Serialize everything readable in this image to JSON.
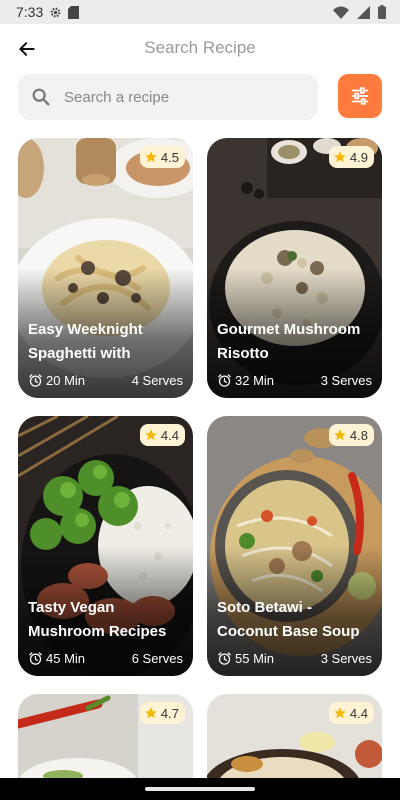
{
  "status_bar": {
    "time": "7:33"
  },
  "header": {
    "title": "Search Recipe"
  },
  "search": {
    "placeholder": "Search a recipe",
    "value": ""
  },
  "colors": {
    "accent": "#ff7a3d",
    "rating_bg": "#fff3d6",
    "star": "#f5b800"
  },
  "recipes": [
    {
      "title": "Easy Weeknight Spaghetti with",
      "rating": "4.5",
      "time": "20 Min",
      "serves": "4 Serves"
    },
    {
      "title": "Gourmet Mushroom Risotto",
      "rating": "4.9",
      "time": "32 Min",
      "serves": "3 Serves"
    },
    {
      "title": "Tasty Vegan Mushroom Recipes",
      "rating": "4.4",
      "time": "45 Min",
      "serves": "6 Serves"
    },
    {
      "title": "Soto Betawi - Coconut Base Soup",
      "rating": "4.8",
      "time": "55 Min",
      "serves": "3 Serves"
    },
    {
      "title": "",
      "rating": "4.7",
      "time": "",
      "serves": ""
    },
    {
      "title": "",
      "rating": "4.4",
      "time": "",
      "serves": ""
    }
  ]
}
